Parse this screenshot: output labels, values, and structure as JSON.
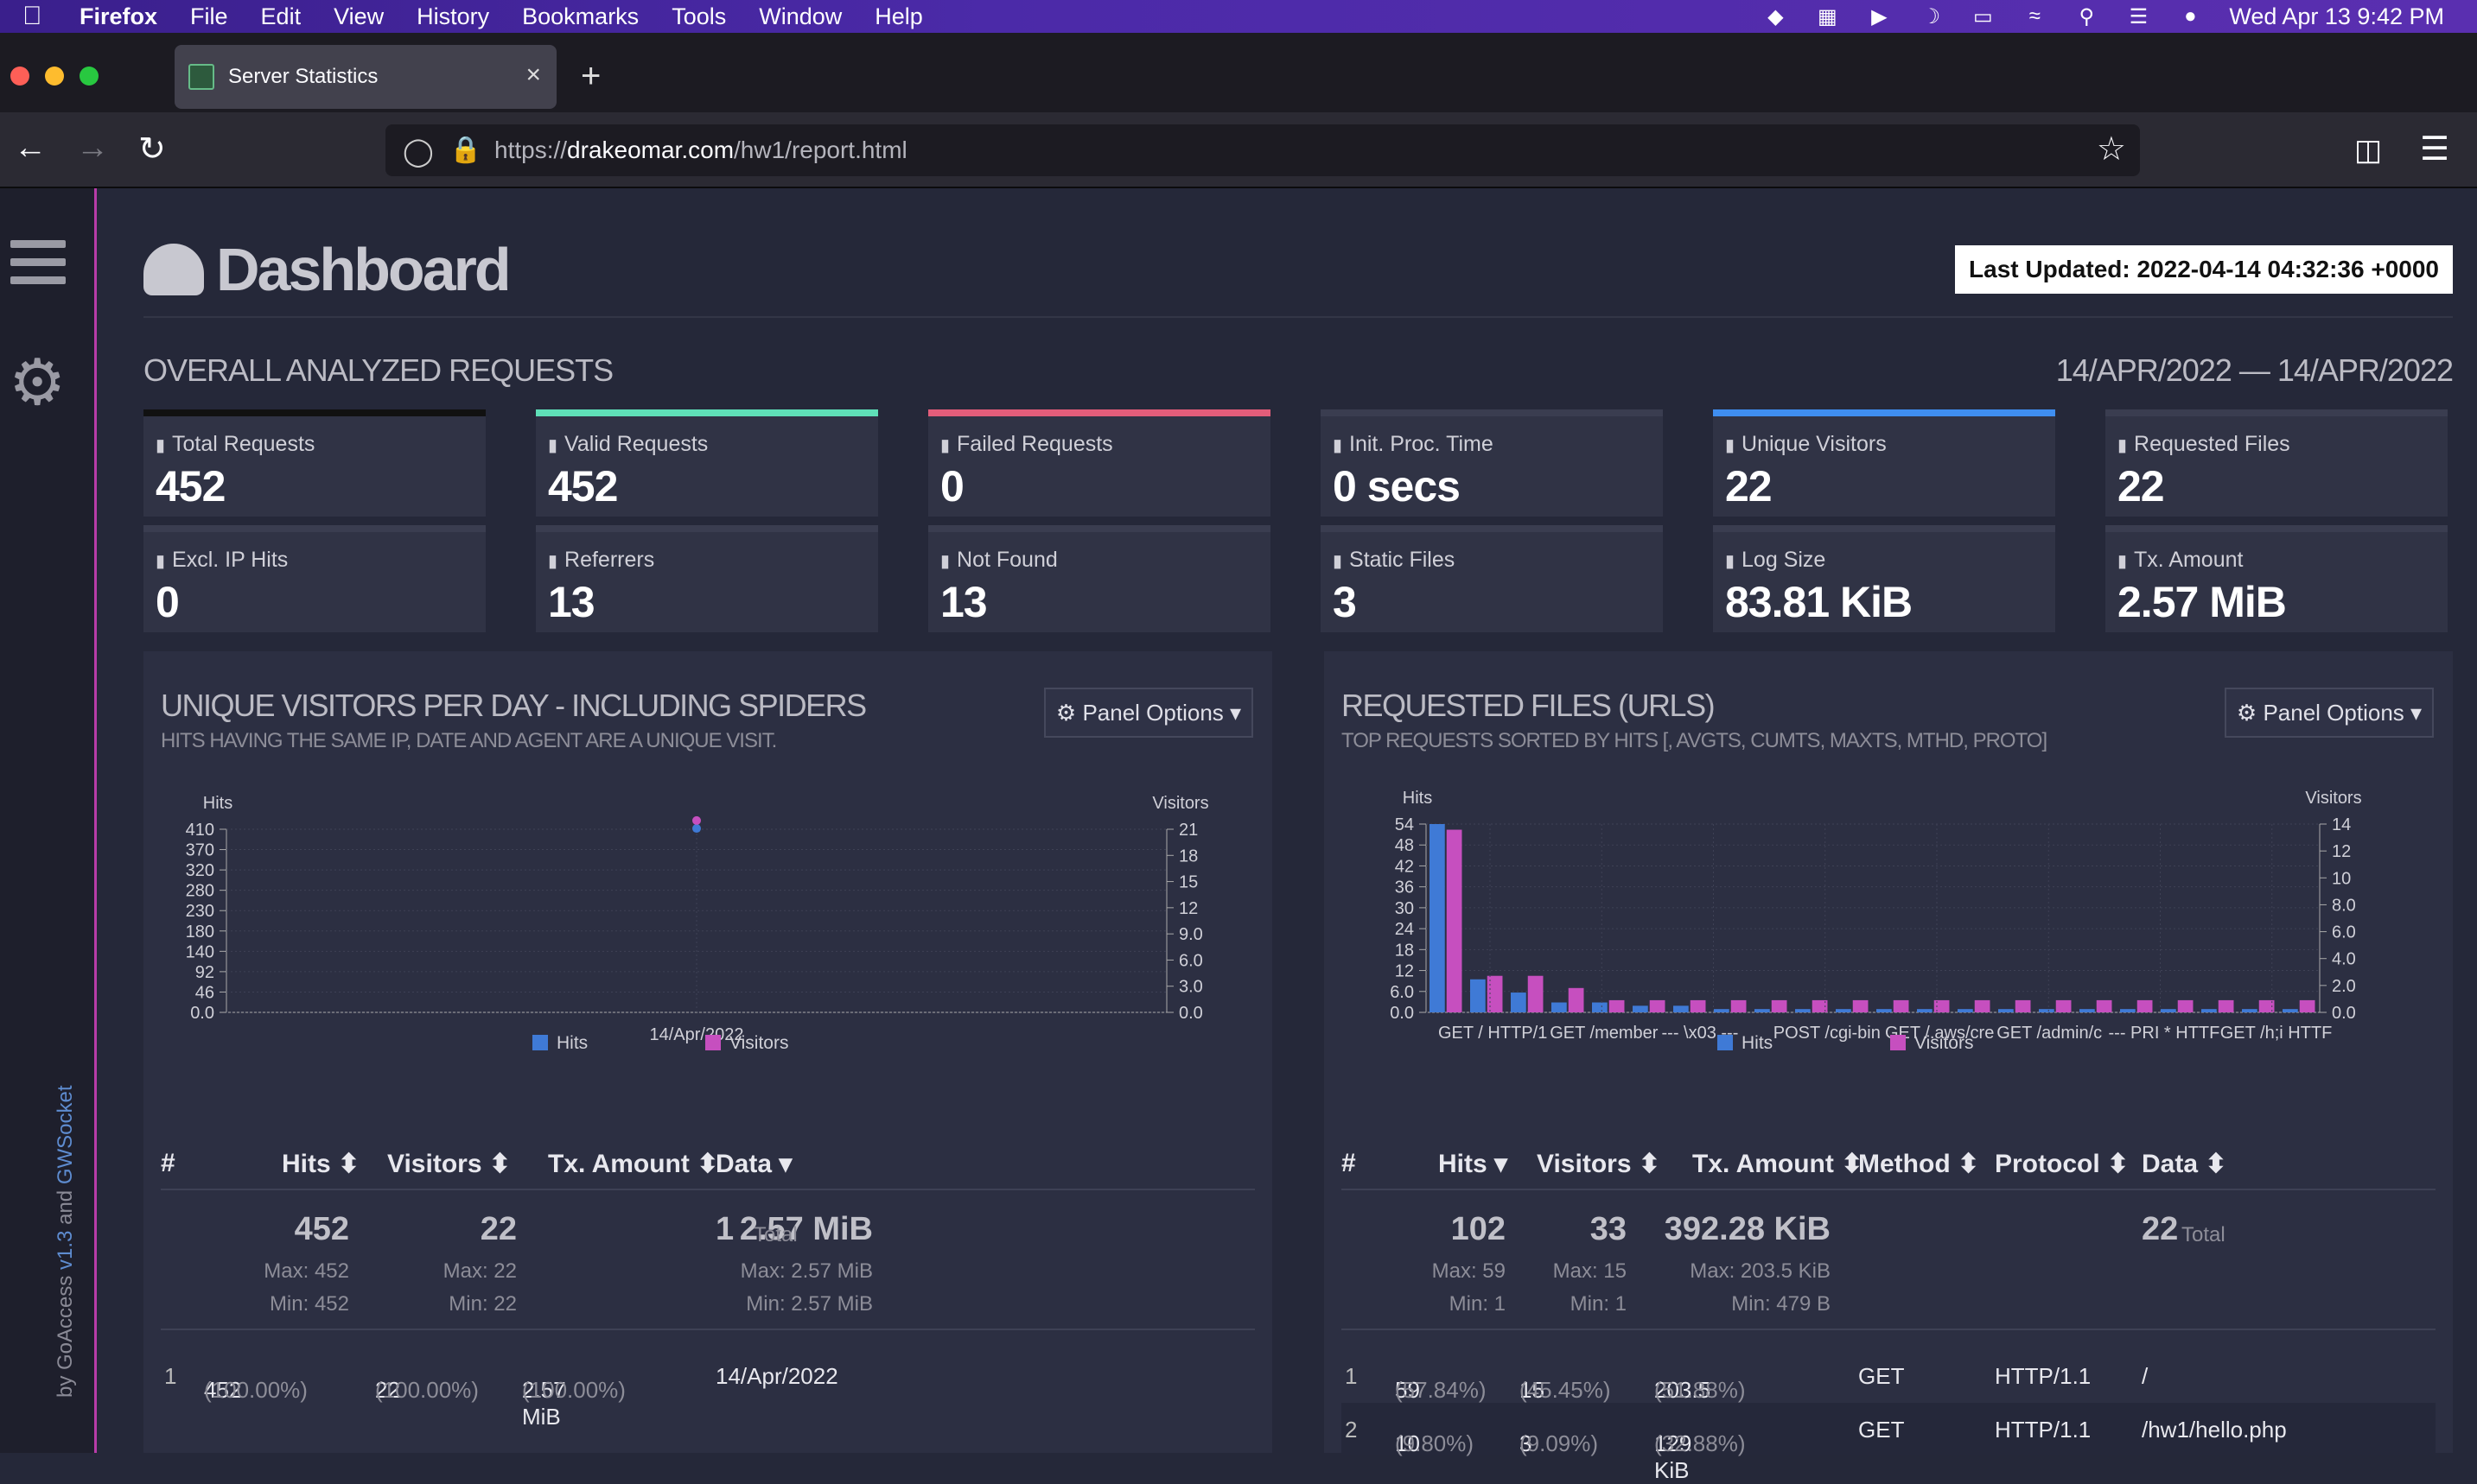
{
  "menubar": {
    "app": "Firefox",
    "items": [
      "File",
      "Edit",
      "View",
      "History",
      "Bookmarks",
      "Tools",
      "Window",
      "Help"
    ],
    "clock": "Wed Apr 13  9:42 PM"
  },
  "browser": {
    "tab_title": "Server Statistics",
    "url_prefix": "https://",
    "url_domain": "drakeomar.com",
    "url_path": "/hw1/report.html"
  },
  "sidebar": {
    "credit_by": "by GoAccess ",
    "credit_version": "v1.3",
    "credit_and": " and ",
    "credit_ws": "GWSocket"
  },
  "header": {
    "title": "Dashboard",
    "last_updated": "Last Updated: 2022-04-14 04:32:36 +0000",
    "section": "OVERALL ANALYZED REQUESTS",
    "date_range": "14/APR/2022 — 14/APR/2022"
  },
  "cards": [
    {
      "label": "Total Requests",
      "value": "452",
      "accent": "#111111"
    },
    {
      "label": "Valid Requests",
      "value": "452",
      "accent": "#5fe0b8"
    },
    {
      "label": "Failed Requests",
      "value": "0",
      "accent": "#e35d7a"
    },
    {
      "label": "Init. Proc. Time",
      "value": "0 secs",
      "accent": "#3a3d50"
    },
    {
      "label": "Unique Visitors",
      "value": "22",
      "accent": "#3f8ef0"
    },
    {
      "label": "Requested Files",
      "value": "22",
      "accent": "#3a3d50"
    },
    {
      "label": "Excl. IP Hits",
      "value": "0",
      "accent": "#3a3d50"
    },
    {
      "label": "Referrers",
      "value": "13",
      "accent": "#3a3d50"
    },
    {
      "label": "Not Found",
      "value": "13",
      "accent": "#3a3d50"
    },
    {
      "label": "Static Files",
      "value": "3",
      "accent": "#3a3d50"
    },
    {
      "label": "Log Size",
      "value": "83.81 KiB",
      "accent": "#3a3d50"
    },
    {
      "label": "Tx. Amount",
      "value": "2.57 MiB",
      "accent": "#3a3d50"
    }
  ],
  "panel_visitors": {
    "title": "UNIQUE VISITORS PER DAY - INCLUDING SPIDERS",
    "subtitle": "HITS HAVING THE SAME IP, DATE AND AGENT ARE A UNIQUE VISIT.",
    "options": "⚙ Panel Options ▾",
    "cols": {
      "num": "#",
      "hits": "Hits ⬍",
      "visitors": "Visitors ⬍",
      "tx": "Tx. Amount ⬍",
      "data": "Data ▾"
    },
    "summary": {
      "hits": "452",
      "hits_max": "Max: 452",
      "hits_min": "Min: 452",
      "visitors": "22",
      "visitors_max": "Max: 22",
      "visitors_min": "Min: 22",
      "tx": "2.57 MiB",
      "tx_max": "Max: 2.57 MiB",
      "tx_min": "Min: 2.57 MiB",
      "data": "1",
      "data_label": "Total"
    },
    "rows": [
      {
        "n": "1",
        "hits": "452",
        "hits_pct": "(100.00%)",
        "visitors": "22",
        "visitors_pct": "(100.00%)",
        "tx": "2.57 MiB",
        "tx_pct": "(100.00%)",
        "data": "14/Apr/2022"
      }
    ]
  },
  "panel_files": {
    "title": "REQUESTED FILES (URLS)",
    "subtitle": "TOP REQUESTS SORTED BY HITS [, AVGTS, CUMTS, MAXTS, MTHD, PROTO]",
    "options": "⚙ Panel Options ▾",
    "cols": {
      "num": "#",
      "hits": "Hits ▾",
      "visitors": "Visitors ⬍",
      "tx": "Tx. Amount ⬍",
      "method": "Method ⬍",
      "protocol": "Protocol ⬍",
      "data": "Data ⬍"
    },
    "summary": {
      "hits": "102",
      "hits_max": "Max: 59",
      "hits_min": "Min: 1",
      "visitors": "33",
      "visitors_max": "Max: 15",
      "visitors_min": "Min: 1",
      "tx": "392.28 KiB",
      "tx_max": "Max: 203.5 KiB",
      "tx_min": "Min: 479 B",
      "data": "22",
      "data_label": "Total"
    },
    "rows": [
      {
        "n": "1",
        "hits": "59",
        "hits_pct": "(57.84%)",
        "visitors": "15",
        "visitors_pct": "(45.45%)",
        "tx": "203.5 KiB",
        "tx_pct": "(51.88%)",
        "method": "GET",
        "protocol": "HTTP/1.1",
        "data": "/"
      },
      {
        "n": "2",
        "hits": "10",
        "hits_pct": "(9.80%)",
        "visitors": "3",
        "visitors_pct": "(9.09%)",
        "tx": "129 KiB",
        "tx_pct": "(32.88%)",
        "method": "GET",
        "protocol": "HTTP/1.1",
        "data": "/hw1/hello.php"
      }
    ]
  },
  "chart_data": [
    {
      "type": "line",
      "ylabel": "Hits",
      "y2label": "Visitors",
      "categories": [
        "14/Apr/2022"
      ],
      "series": [
        {
          "name": "Hits",
          "values": [
            452
          ],
          "color": "#3f7ad6"
        },
        {
          "name": "Visitors",
          "values": [
            22
          ],
          "color": "#c64fbf"
        }
      ],
      "yticks": [
        "0.0",
        "46",
        "92",
        "140",
        "180",
        "230",
        "280",
        "320",
        "370",
        "410"
      ],
      "y2ticks": [
        "0.0",
        "3.0",
        "6.0",
        "9.0",
        "12",
        "15",
        "18",
        "21"
      ],
      "legend": "bottom"
    },
    {
      "type": "bar",
      "ylabel": "Hits",
      "y2label": "Visitors",
      "xticklabels": [
        "GET / HTTP/1",
        "GET /member",
        "--- \\x03 ---",
        "POST /cgi-bin",
        "GET /.aws/cre",
        "GET /admin/c",
        "--- PRI * HTTF",
        "GET /h;i HTTF"
      ],
      "series": [
        {
          "name": "Hits",
          "values": [
            59,
            10,
            6,
            3,
            3,
            2,
            2,
            1,
            1,
            1,
            1,
            1,
            1,
            1,
            1,
            1,
            1,
            1,
            1,
            1,
            1,
            1
          ],
          "color": "#3f7ad6"
        },
        {
          "name": "Visitors",
          "values": [
            15,
            3,
            3,
            2,
            1,
            1,
            1,
            1,
            1,
            1,
            1,
            1,
            1,
            1,
            1,
            1,
            1,
            1,
            1,
            1,
            1,
            1
          ],
          "color": "#c64fbf"
        }
      ],
      "yticks": [
        "0.0",
        "6.0",
        "12",
        "18",
        "24",
        "30",
        "36",
        "42",
        "48",
        "54"
      ],
      "y2ticks": [
        "0.0",
        "2.0",
        "4.0",
        "6.0",
        "8.0",
        "10",
        "12",
        "14"
      ],
      "ymax": 59,
      "y2max": 15,
      "legend": "bottom"
    }
  ]
}
